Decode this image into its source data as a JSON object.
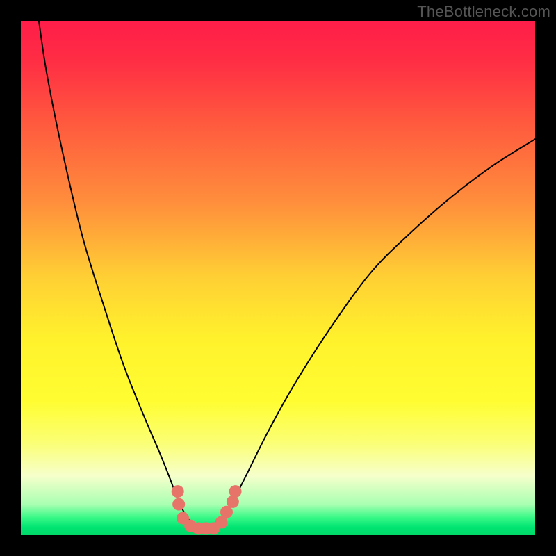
{
  "watermark": "TheBottleneck.com",
  "colors": {
    "black": "#000000",
    "curve": "#000000",
    "marker": "#e77469",
    "gradient_stops": [
      {
        "offset": 0.0,
        "color": "#ff1d49"
      },
      {
        "offset": 0.08,
        "color": "#ff2e44"
      },
      {
        "offset": 0.2,
        "color": "#ff5a3e"
      },
      {
        "offset": 0.35,
        "color": "#ff8d3c"
      },
      {
        "offset": 0.5,
        "color": "#ffd034"
      },
      {
        "offset": 0.62,
        "color": "#fff22c"
      },
      {
        "offset": 0.74,
        "color": "#fffd32"
      },
      {
        "offset": 0.82,
        "color": "#fbff74"
      },
      {
        "offset": 0.885,
        "color": "#f6ffcb"
      },
      {
        "offset": 0.94,
        "color": "#a9ffb2"
      },
      {
        "offset": 0.965,
        "color": "#3cf988"
      },
      {
        "offset": 0.985,
        "color": "#00e472"
      },
      {
        "offset": 1.0,
        "color": "#00d868"
      }
    ]
  },
  "chart_data": {
    "type": "line",
    "title": "",
    "xlabel": "",
    "ylabel": "",
    "xlim": [
      0,
      100
    ],
    "ylim": [
      0,
      100
    ],
    "curve": [
      {
        "x": 3.5,
        "y": 100
      },
      {
        "x": 5,
        "y": 90
      },
      {
        "x": 8,
        "y": 75
      },
      {
        "x": 12,
        "y": 58
      },
      {
        "x": 16,
        "y": 45
      },
      {
        "x": 20,
        "y": 33
      },
      {
        "x": 24,
        "y": 23
      },
      {
        "x": 27,
        "y": 16
      },
      {
        "x": 29,
        "y": 11
      },
      {
        "x": 30.5,
        "y": 7
      },
      {
        "x": 32,
        "y": 4
      },
      {
        "x": 33.5,
        "y": 2
      },
      {
        "x": 35,
        "y": 1.2
      },
      {
        "x": 37,
        "y": 1.2
      },
      {
        "x": 38.5,
        "y": 2
      },
      {
        "x": 40,
        "y": 4
      },
      {
        "x": 41.5,
        "y": 7
      },
      {
        "x": 44,
        "y": 12
      },
      {
        "x": 48,
        "y": 20
      },
      {
        "x": 53,
        "y": 29
      },
      {
        "x": 60,
        "y": 40
      },
      {
        "x": 68,
        "y": 51
      },
      {
        "x": 76,
        "y": 59
      },
      {
        "x": 84,
        "y": 66
      },
      {
        "x": 92,
        "y": 72
      },
      {
        "x": 100,
        "y": 77
      }
    ],
    "markers": [
      {
        "x": 30.5,
        "y": 8.5
      },
      {
        "x": 30.7,
        "y": 6.0
      },
      {
        "x": 31.5,
        "y": 3.3
      },
      {
        "x": 33.0,
        "y": 1.8
      },
      {
        "x": 34.5,
        "y": 1.3
      },
      {
        "x": 36.0,
        "y": 1.3
      },
      {
        "x": 37.5,
        "y": 1.3
      },
      {
        "x": 39.0,
        "y": 2.5
      },
      {
        "x": 40.0,
        "y": 4.5
      },
      {
        "x": 41.2,
        "y": 6.5
      },
      {
        "x": 41.7,
        "y": 8.5
      }
    ]
  }
}
